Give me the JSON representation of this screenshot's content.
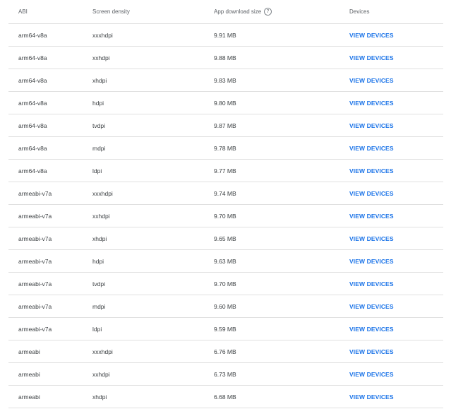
{
  "table": {
    "headers": {
      "abi": "ABI",
      "density": "Screen density",
      "size": "App download size",
      "size_help_icon": "help-circle-icon",
      "devices": "Devices"
    },
    "rows": [
      {
        "abi": "arm64-v8a",
        "density": "xxxhdpi",
        "size": "9.91 MB",
        "action": "VIEW DEVICES"
      },
      {
        "abi": "arm64-v8a",
        "density": "xxhdpi",
        "size": "9.88 MB",
        "action": "VIEW DEVICES"
      },
      {
        "abi": "arm64-v8a",
        "density": "xhdpi",
        "size": "9.83 MB",
        "action": "VIEW DEVICES"
      },
      {
        "abi": "arm64-v8a",
        "density": "hdpi",
        "size": "9.80 MB",
        "action": "VIEW DEVICES"
      },
      {
        "abi": "arm64-v8a",
        "density": "tvdpi",
        "size": "9.87 MB",
        "action": "VIEW DEVICES"
      },
      {
        "abi": "arm64-v8a",
        "density": "mdpi",
        "size": "9.78 MB",
        "action": "VIEW DEVICES"
      },
      {
        "abi": "arm64-v8a",
        "density": "ldpi",
        "size": "9.77 MB",
        "action": "VIEW DEVICES"
      },
      {
        "abi": "armeabi-v7a",
        "density": "xxxhdpi",
        "size": "9.74 MB",
        "action": "VIEW DEVICES"
      },
      {
        "abi": "armeabi-v7a",
        "density": "xxhdpi",
        "size": "9.70 MB",
        "action": "VIEW DEVICES"
      },
      {
        "abi": "armeabi-v7a",
        "density": "xhdpi",
        "size": "9.65 MB",
        "action": "VIEW DEVICES"
      },
      {
        "abi": "armeabi-v7a",
        "density": "hdpi",
        "size": "9.63 MB",
        "action": "VIEW DEVICES"
      },
      {
        "abi": "armeabi-v7a",
        "density": "tvdpi",
        "size": "9.70 MB",
        "action": "VIEW DEVICES"
      },
      {
        "abi": "armeabi-v7a",
        "density": "mdpi",
        "size": "9.60 MB",
        "action": "VIEW DEVICES"
      },
      {
        "abi": "armeabi-v7a",
        "density": "ldpi",
        "size": "9.59 MB",
        "action": "VIEW DEVICES"
      },
      {
        "abi": "armeabi",
        "density": "xxxhdpi",
        "size": "6.76 MB",
        "action": "VIEW DEVICES"
      },
      {
        "abi": "armeabi",
        "density": "xxhdpi",
        "size": "6.73 MB",
        "action": "VIEW DEVICES"
      },
      {
        "abi": "armeabi",
        "density": "xhdpi",
        "size": "6.68 MB",
        "action": "VIEW DEVICES"
      }
    ]
  },
  "colors": {
    "link": "#1a73e8",
    "divider": "#e0e0e0",
    "text": "#3c4043",
    "header_text": "#5f6368"
  }
}
